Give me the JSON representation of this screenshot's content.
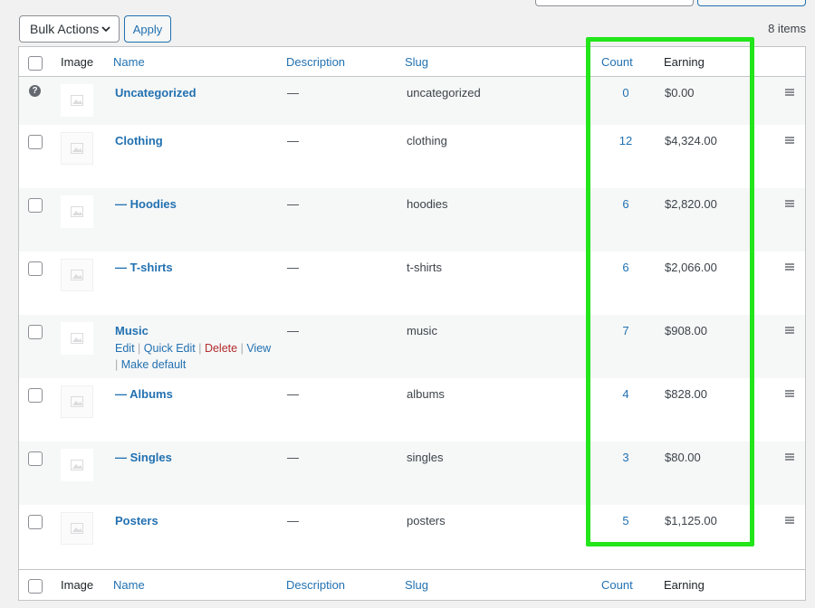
{
  "bulk_actions": {
    "label": "Bulk Actions",
    "apply_label": "Apply"
  },
  "items_count": "8 items",
  "columns": {
    "image": "Image",
    "name": "Name",
    "description": "Description",
    "slug": "Slug",
    "count": "Count",
    "earning": "Earning"
  },
  "rows": [
    {
      "name": "Uncategorized",
      "description": "—",
      "slug": "uncategorized",
      "count": "0",
      "earning": "$0.00"
    },
    {
      "name": "Clothing",
      "description": "—",
      "slug": "clothing",
      "count": "12",
      "earning": "$4,324.00"
    },
    {
      "name": "— Hoodies",
      "description": "—",
      "slug": "hoodies",
      "count": "6",
      "earning": "$2,820.00"
    },
    {
      "name": "— T-shirts",
      "description": "—",
      "slug": "t-shirts",
      "count": "6",
      "earning": "$2,066.00"
    },
    {
      "name": "Music",
      "description": "—",
      "slug": "music",
      "count": "7",
      "earning": "$908.00"
    },
    {
      "name": "— Albums",
      "description": "—",
      "slug": "albums",
      "count": "4",
      "earning": "$828.00"
    },
    {
      "name": "— Singles",
      "description": "—",
      "slug": "singles",
      "count": "3",
      "earning": "$80.00"
    },
    {
      "name": "Posters",
      "description": "—",
      "slug": "posters",
      "count": "5",
      "earning": "$1,125.00"
    }
  ],
  "row_actions": {
    "edit": "Edit",
    "quick_edit": "Quick Edit",
    "delete": "Delete",
    "view": "View",
    "make_default": "Make default",
    "separator": "|"
  },
  "help_icon_glyph": "?",
  "colors": {
    "link": "#2271b1",
    "delete": "#b32d2e",
    "highlight": "#22e51a",
    "alt_row": "#f6f7f7"
  }
}
